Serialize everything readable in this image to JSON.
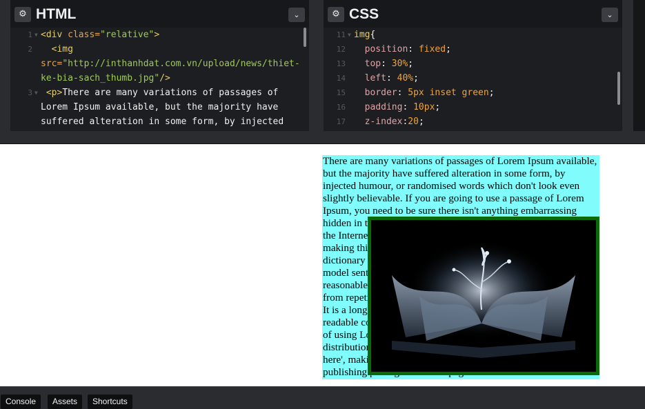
{
  "html_panel": {
    "title": "HTML",
    "line_numbers": [
      "1",
      "2",
      "",
      "",
      "3",
      "",
      ""
    ],
    "lines": [
      {
        "parts": [
          [
            "tag",
            "<div "
          ],
          [
            "attr",
            "class="
          ],
          [
            "str",
            "\"relative\""
          ],
          [
            "tag",
            ">"
          ]
        ]
      },
      {
        "parts": [
          [
            "tag",
            "  <img"
          ]
        ]
      },
      {
        "parts": [
          [
            "attr",
            "src="
          ],
          [
            "str",
            "\"http://inthanhdat.com.vn/upload/news/thiet-"
          ]
        ]
      },
      {
        "parts": [
          [
            "str",
            "ke-bia-sach_thumb.jpg\""
          ],
          [
            "tag",
            "/>"
          ]
        ]
      },
      {
        "parts": [
          [
            "tag",
            " <p>"
          ],
          [
            "txt",
            "There are many variations of passages of"
          ]
        ]
      },
      {
        "parts": [
          [
            "txt",
            "Lorem Ipsum available, but the majority have"
          ]
        ]
      },
      {
        "parts": [
          [
            "txt",
            "suffered alteration in some form, by injected"
          ]
        ]
      }
    ]
  },
  "css_panel": {
    "title": "CSS",
    "line_numbers": [
      "11",
      "12",
      "13",
      "14",
      "15",
      "16",
      "17"
    ],
    "lines": [
      {
        "parts": [
          [
            "sel",
            "img"
          ],
          [
            "txt",
            "{"
          ]
        ]
      },
      {
        "parts": [
          [
            "prop",
            "  position"
          ],
          [
            "txt",
            ": "
          ],
          [
            "val",
            "fixed"
          ],
          [
            "txt",
            ";"
          ]
        ]
      },
      {
        "parts": [
          [
            "prop",
            "  top"
          ],
          [
            "txt",
            ": "
          ],
          [
            "val",
            "30%"
          ],
          [
            "txt",
            ";"
          ]
        ]
      },
      {
        "parts": [
          [
            "prop",
            "  left"
          ],
          [
            "txt",
            ": "
          ],
          [
            "val",
            "40%"
          ],
          [
            "txt",
            ";"
          ]
        ]
      },
      {
        "parts": [
          [
            "prop",
            "  border"
          ],
          [
            "txt",
            ": "
          ],
          [
            "val",
            "5px inset green"
          ],
          [
            "txt",
            ";"
          ]
        ]
      },
      {
        "parts": [
          [
            "prop",
            "  padding"
          ],
          [
            "txt",
            ": "
          ],
          [
            "val",
            "10px"
          ],
          [
            "txt",
            ";"
          ]
        ]
      },
      {
        "parts": [
          [
            "prop",
            "  z-index"
          ],
          [
            "txt",
            ":"
          ],
          [
            "val",
            "20"
          ],
          [
            "txt",
            ";"
          ]
        ]
      }
    ]
  },
  "preview": {
    "paragraph": "There are many variations of passages of Lorem Ipsum available, but the majority have suffered alteration in some form, by injected humour, or randomised words which don't look even slightly believable. If you are going to use a passage of Lorem Ipsum, you need to be sure there isn't anything embarrassing hidden in the middle of text. All the Lorem Ipsum generators on the Internet tend to repeat predefined chunks as necessary, making this the first true generator on the Internet. It uses a dictionary of over 200 Latin words, combined with a handful of model sentence structures, to generate Lorem Ipsum which looks reasonable. The generated Lorem Ipsum is therefore always free from repetition, injected humour, or non-characteristic words etc. It is a long established fact that a reader will be distracted by the readable content of a page when looking at its layout. The point of using Lorem Ipsum is that it has a more-or-less normal distribution of letters, as opposed to using 'Content here, content here', making it look like readable English. Many desktop publishing packages and web page editors now",
    "image_alt": "open book image"
  },
  "console_bar": {
    "buttons": [
      "Console",
      "Assets",
      "Shortcuts"
    ]
  },
  "colors": {
    "editor_bg": "#1d1e22",
    "preview_highlight": "#7ffcfb",
    "image_border": "#0a6a0a"
  }
}
